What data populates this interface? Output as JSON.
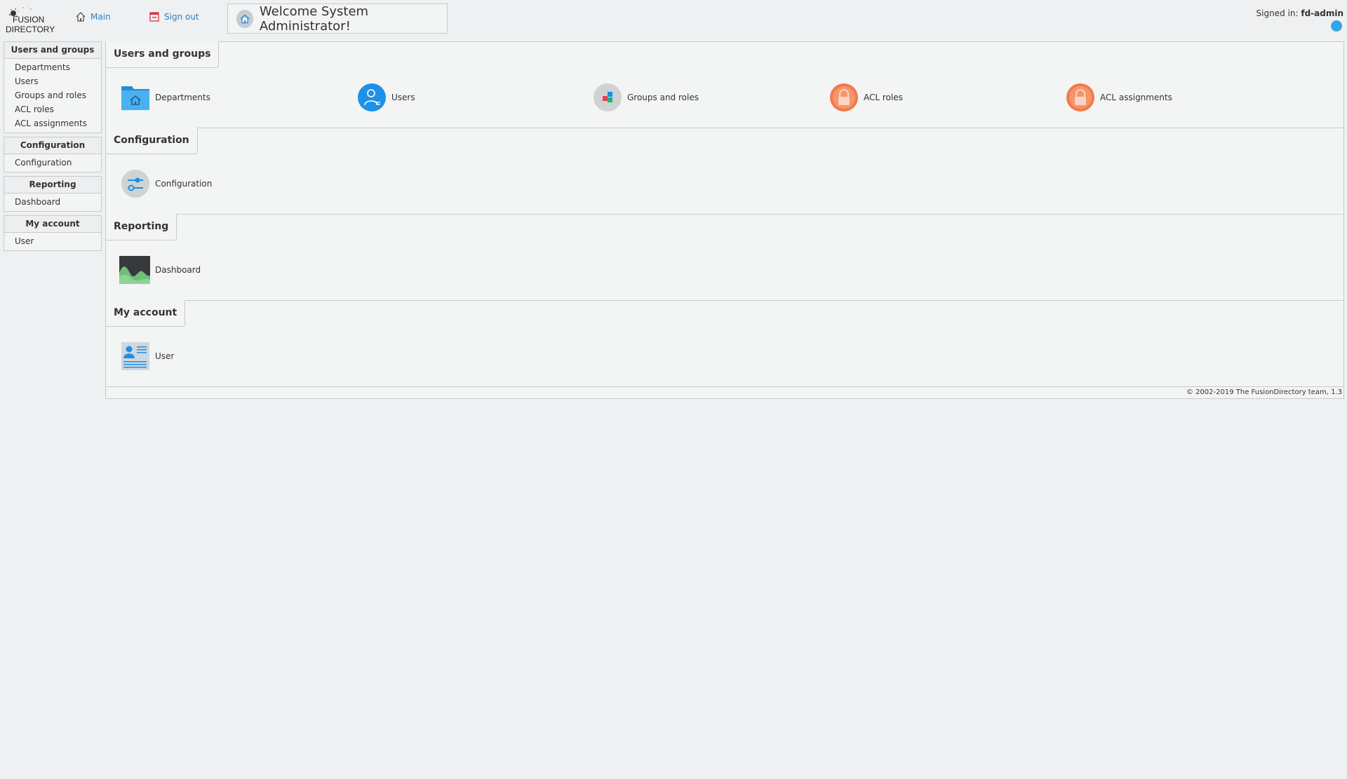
{
  "header": {
    "logo_line1": "FUSION",
    "logo_line2": "DIRECTORY",
    "main_link": "Main",
    "signout_link": "Sign out",
    "welcome": "Welcome System Administrator!",
    "signed_in_label": "Signed in:",
    "signed_in_user": "fd-admin"
  },
  "sidebar": {
    "groups": [
      {
        "title": "Users and groups",
        "items": [
          "Departments",
          "Users",
          "Groups and roles",
          "ACL roles",
          "ACL assignments"
        ]
      },
      {
        "title": "Configuration",
        "items": [
          "Configuration"
        ]
      },
      {
        "title": "Reporting",
        "items": [
          "Dashboard"
        ]
      },
      {
        "title": "My account",
        "items": [
          "User"
        ]
      }
    ]
  },
  "main": {
    "sections": [
      {
        "title": "Users and groups",
        "items": [
          "Departments",
          "Users",
          "Groups and roles",
          "ACL roles",
          "ACL assignments"
        ]
      },
      {
        "title": "Configuration",
        "items": [
          "Configuration"
        ]
      },
      {
        "title": "Reporting",
        "items": [
          "Dashboard"
        ]
      },
      {
        "title": "My account",
        "items": [
          "User"
        ]
      }
    ],
    "footer": "© 2002-2019 The FusionDirectory team, 1.3"
  },
  "icons": {
    "departments": "folder-home-icon",
    "users": "user-icon",
    "groups": "groups-icon",
    "acl_roles": "lock-icon",
    "acl_assignments": "lock-icon",
    "configuration": "sliders-icon",
    "dashboard": "chart-area-icon",
    "user": "id-card-icon"
  },
  "colors": {
    "link": "#2a7fc0",
    "status": "#35a4e5",
    "acl": "#f27a4a"
  }
}
